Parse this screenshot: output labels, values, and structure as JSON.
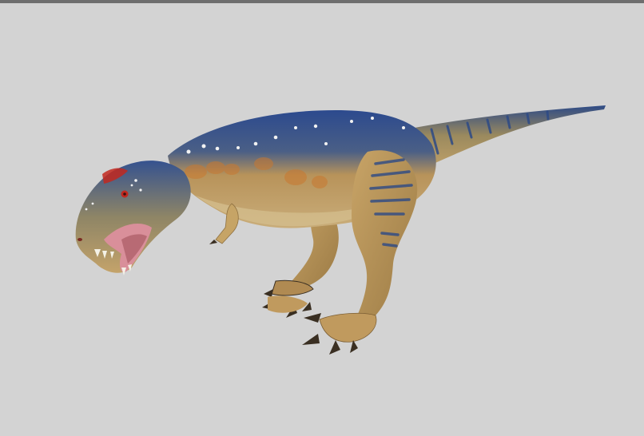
{
  "scene": {
    "subject": "tyrannosaurus-render",
    "colors": {
      "background": "#d3d3d3",
      "top_bar": "#6e6e6e",
      "back": "#2f4c8c",
      "body": "#b8935a",
      "belly": "#c9ad7a",
      "stripe": "#2d4a86",
      "orange_patch": "#c9782f",
      "mouth": "#d98f9a",
      "eye_red": "#c2281f",
      "claw": "#3a2f22",
      "spots": "#f2f2f2"
    }
  }
}
